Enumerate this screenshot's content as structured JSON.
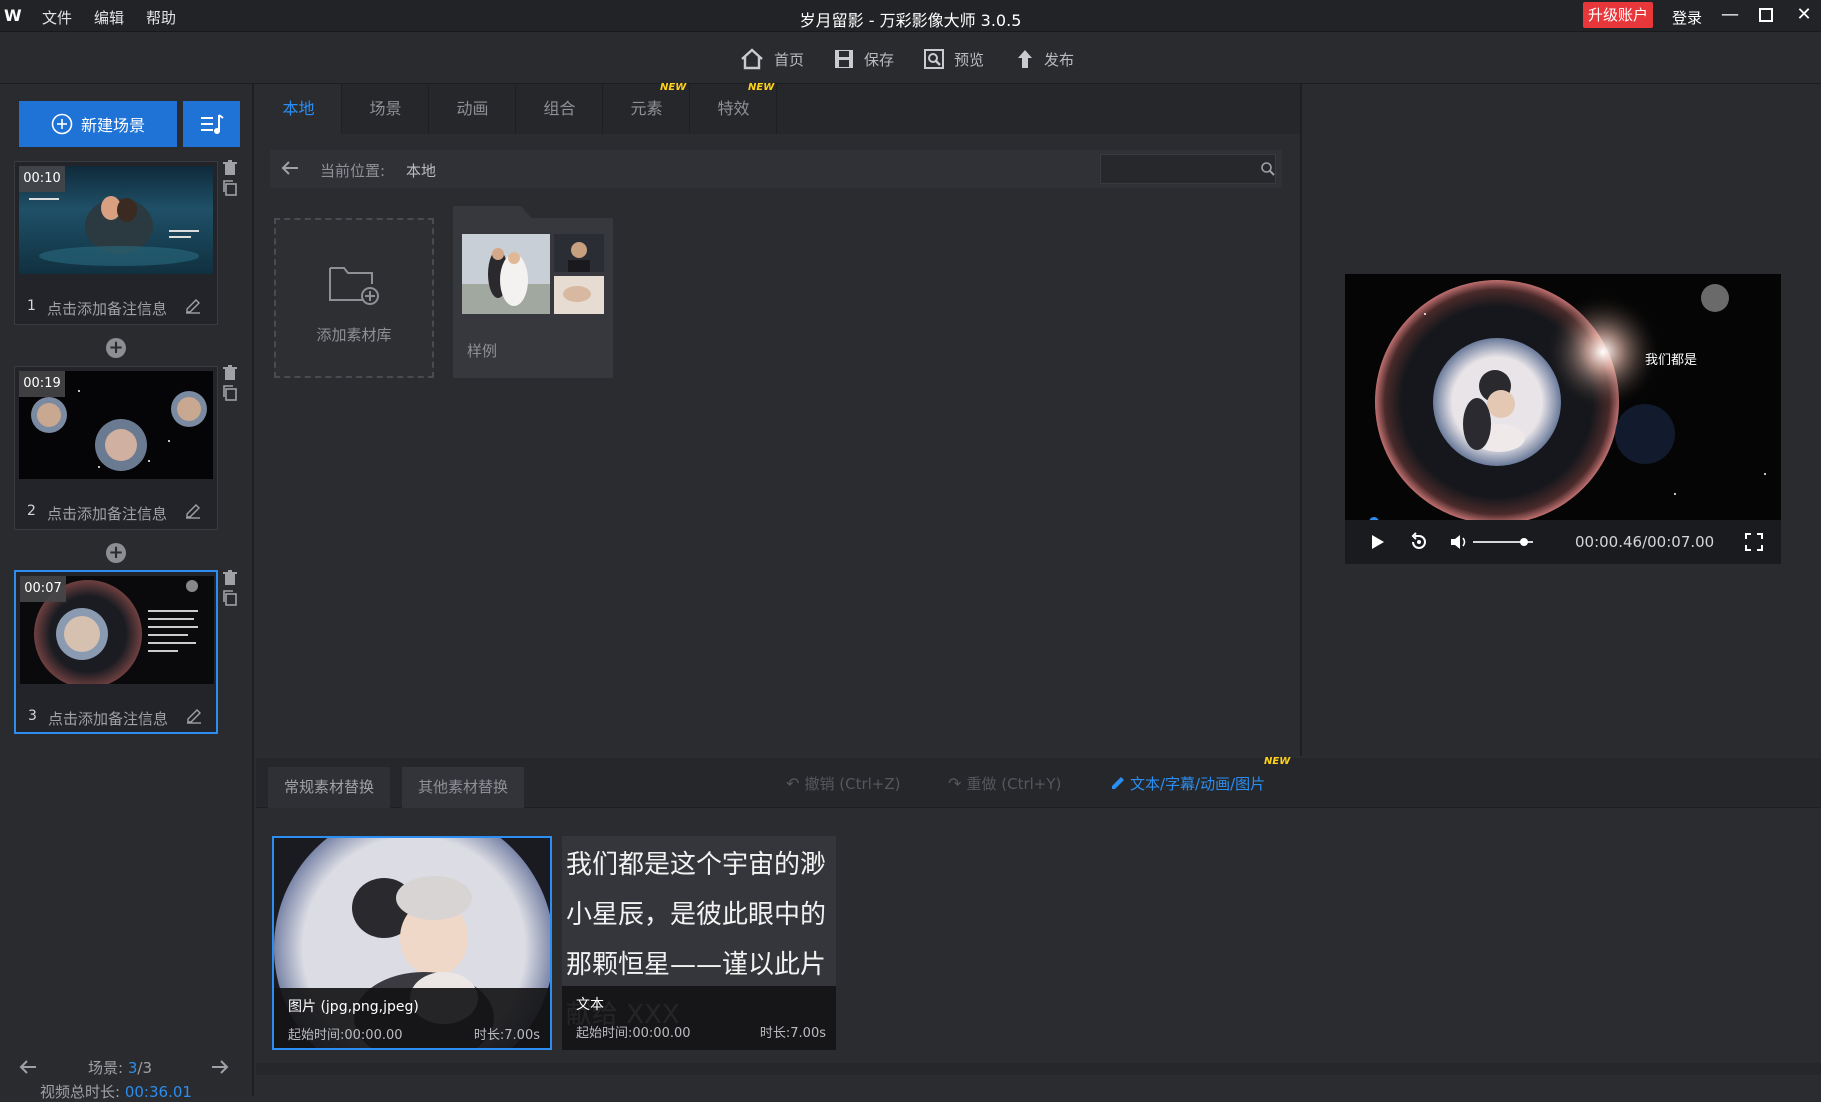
{
  "titlebar": {
    "logo": "W",
    "menus": [
      "文件",
      "编辑",
      "帮助"
    ],
    "title": "岁月留影 - 万彩影像大师 3.0.5",
    "upgrade": "升级账户",
    "login": "登录"
  },
  "toolbar": {
    "home": "首页",
    "save": "保存",
    "preview": "预览",
    "publish": "发布"
  },
  "left": {
    "new_scene": "新建场景",
    "scenes": [
      {
        "num": "1",
        "time": "00:10",
        "note": "点击添加备注信息"
      },
      {
        "num": "2",
        "time": "00:19",
        "note": "点击添加备注信息"
      },
      {
        "num": "3",
        "time": "00:07",
        "note": "点击添加备注信息"
      }
    ],
    "scene_label": "场景:",
    "scene_current": "3",
    "scene_total": "/3",
    "duration_label": "视频总时长:",
    "duration_value": "00:36.01"
  },
  "center": {
    "tabs": [
      "本地",
      "场景",
      "动画",
      "组合",
      "元素",
      "特效"
    ],
    "active_tab": "本地",
    "new_badge": "NEW",
    "location_label": "当前位置:",
    "location_value": "本地",
    "search_value": "",
    "add_library": "添加素材库",
    "sample_folder": "样例"
  },
  "preview": {
    "overlay_text": "我们都是",
    "time": "00:00.46/00:07.00",
    "progress": 0.066,
    "volume": 0.85
  },
  "bottom": {
    "tab_regular": "常规素材替换",
    "tab_other": "其他素材替换",
    "undo": "撤销 (Ctrl+Z)",
    "redo": "重做 (Ctrl+Y)",
    "text_link": "文本/字幕/动画/图片",
    "new_badge": "NEW",
    "image_card": {
      "type": "图片 (jpg,png,jpeg)",
      "start": "起始时间:00:00.00",
      "duration": "时长:7.00s"
    },
    "text_card": {
      "content": "我们都是这个宇宙的渺小星辰，是彼此眼中的那颗恒星——谨以此片献给 XXX",
      "type": "文本",
      "start": "起始时间:00:00.00",
      "duration": "时长:7.00s"
    }
  },
  "colors": {
    "accent": "#2b8ef0",
    "button_blue": "#1f73d6",
    "upgrade_red": "#e8373a",
    "new_yellow": "#ffd21a"
  }
}
